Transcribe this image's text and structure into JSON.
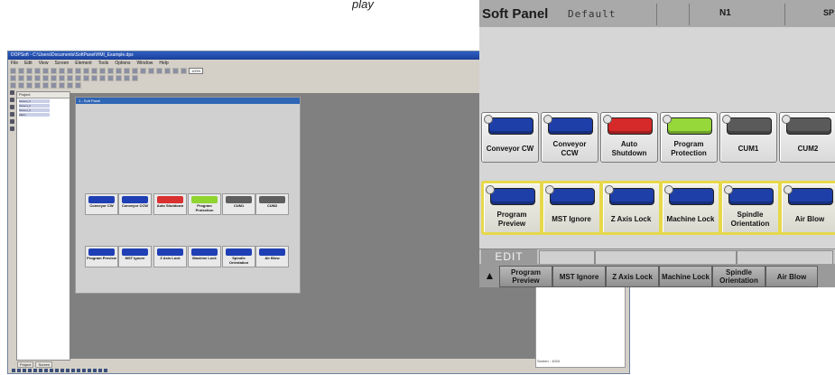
{
  "top_fragment": "play",
  "editor": {
    "window_title": "DOPSoft - C:\\Users\\Documents\\SoftPanel\\HMI_Example.dps",
    "menu": [
      "File",
      "Edit",
      "View",
      "Screen",
      "Element",
      "Tools",
      "Options",
      "Window",
      "Help"
    ],
    "zoom": "100%",
    "tree_header": "Project",
    "tree_items": [
      "Screen_1",
      "Screen_2",
      "Screen_3",
      "Alarm"
    ],
    "screen_title": "1 - Soft Panel",
    "mini_buttons": [
      {
        "label": "Conveyor CW",
        "color": "#1f3fb5"
      },
      {
        "label": "Conveyor CCW",
        "color": "#1f3fb5"
      },
      {
        "label": "Auto Shutdown",
        "color": "#d93030"
      },
      {
        "label": "Program Protection",
        "color": "#8fd42f"
      },
      {
        "label": "CUM1",
        "color": "#5e5e5e"
      },
      {
        "label": "CUM2",
        "color": "#5e5e5e"
      },
      {
        "label": "Program Preview",
        "color": "#1f3fb5"
      },
      {
        "label": "MST Ignore",
        "color": "#1f3fb5"
      },
      {
        "label": "Z Axis Lock",
        "color": "#1f3fb5"
      },
      {
        "label": "Machine Lock",
        "color": "#1f3fb5"
      },
      {
        "label": "Spindle Orientation",
        "color": "#1f3fb5"
      },
      {
        "label": "Air Blow",
        "color": "#1f3fb5"
      }
    ],
    "tabs": [
      "Project",
      "Screen"
    ],
    "status_right": "Screen : 1024"
  },
  "soft_panel": {
    "title": "Soft Panel",
    "mode": "Default",
    "n_label": "N1",
    "sp_label": "SP",
    "keys_row1": [
      {
        "label": "Conveyor CW",
        "color": "#1e3fa8"
      },
      {
        "label": "Conveyor CCW",
        "color": "#1e3fa8"
      },
      {
        "label": "Auto Shutdown",
        "color": "#d62a2a"
      },
      {
        "label": "Program Protection",
        "color": "#96d83a"
      },
      {
        "label": "CUM1",
        "color": "#5a5a5a"
      },
      {
        "label": "CUM2",
        "color": "#5a5a5a"
      }
    ],
    "keys_row2": [
      {
        "label": "Program Preview",
        "color": "#1e3fa8"
      },
      {
        "label": "MST Ignore",
        "color": "#1e3fa8"
      },
      {
        "label": "Z Axis Lock",
        "color": "#1e3fa8"
      },
      {
        "label": "Machine Lock",
        "color": "#1e3fa8"
      },
      {
        "label": "Spindle Orientation",
        "color": "#1e3fa8"
      },
      {
        "label": "Air Blow",
        "color": "#1e3fa8"
      }
    ],
    "edit_label": "EDIT",
    "softkeys": [
      "Program Preview",
      "MST Ignore",
      "Z Axis Lock",
      "Machine Lock",
      "Spindle Orientation",
      "Air Blow"
    ]
  }
}
